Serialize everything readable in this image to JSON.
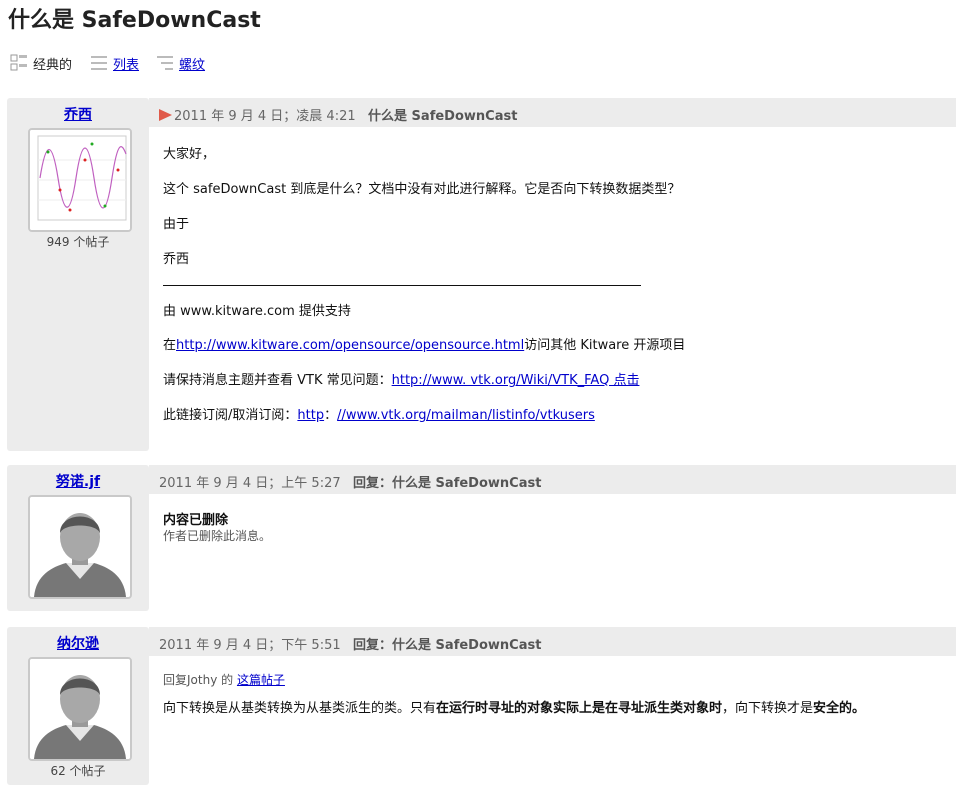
{
  "page": {
    "title": "什么是 SafeDownCast"
  },
  "views": [
    {
      "label": "经典的",
      "link": false
    },
    {
      "label": "列表",
      "link": true
    },
    {
      "label": "螺纹",
      "link": true
    }
  ],
  "posts": [
    {
      "author": "乔西",
      "post_count": "949 个帖子",
      "date": "2011 年 9 月 4 日；凌晨 4:21",
      "subject": "什么是 SafeDownCast",
      "lines": {
        "greeting": "大家好，",
        "question": "这个 safeDownCast 到底是什么？文档中没有对此进行解释。它是否向下转换数据类型？",
        "regards": "由于",
        "signature": "乔西",
        "powered_by": "由 www.kitware.com 提供支持",
        "visit_prefix": "在",
        "visit_link": "http://www.kitware.com/opensource/opensource.html",
        "visit_suffix": "访问其他 Kitware 开源项目",
        "faq_prefix": "请保持消息主题并查看 VTK 常见问题：",
        "faq_link": "http://www. vtk.org/Wiki/VTK_FAQ 点击",
        "sub_prefix": "此链接订阅/取消订阅：",
        "sub_link1": "http",
        "sub_sep": "：",
        "sub_link2": "//www.vtk.org/mailman/listinfo/vtkusers"
      }
    },
    {
      "author": "努诺.jf",
      "date": "2011 年 9 月 4 日；上午 5:27",
      "subject": "回复：什么是 SafeDownCast",
      "deleted_title": "内容已删除",
      "deleted_note": "作者已删除此消息。"
    },
    {
      "author": "纳尔逊",
      "post_count": "62 个帖子",
      "date": "2011 年 9 月 4 日；下午 5:51",
      "subject": "回复：什么是 SafeDownCast",
      "reply_prefix": "回复Jothy 的",
      "reply_link": "这篇帖子",
      "body_part1": "向下转换是从基类转换为从基类派生的类。只有",
      "body_bold1": "在运行时寻址的对象实际上是在寻址派生类对象时",
      "body_part2": "，向下转换才是",
      "body_bold2": "安全的。"
    }
  ],
  "colors": {
    "header_bg": "#ececec",
    "link": "#0000cc",
    "arrow": "#e05a4a"
  },
  "icons": [
    "classic-view-icon",
    "list-view-icon",
    "threaded-view-icon",
    "new-post-arrow-icon",
    "default-avatar-icon",
    "chart-avatar-image"
  ]
}
